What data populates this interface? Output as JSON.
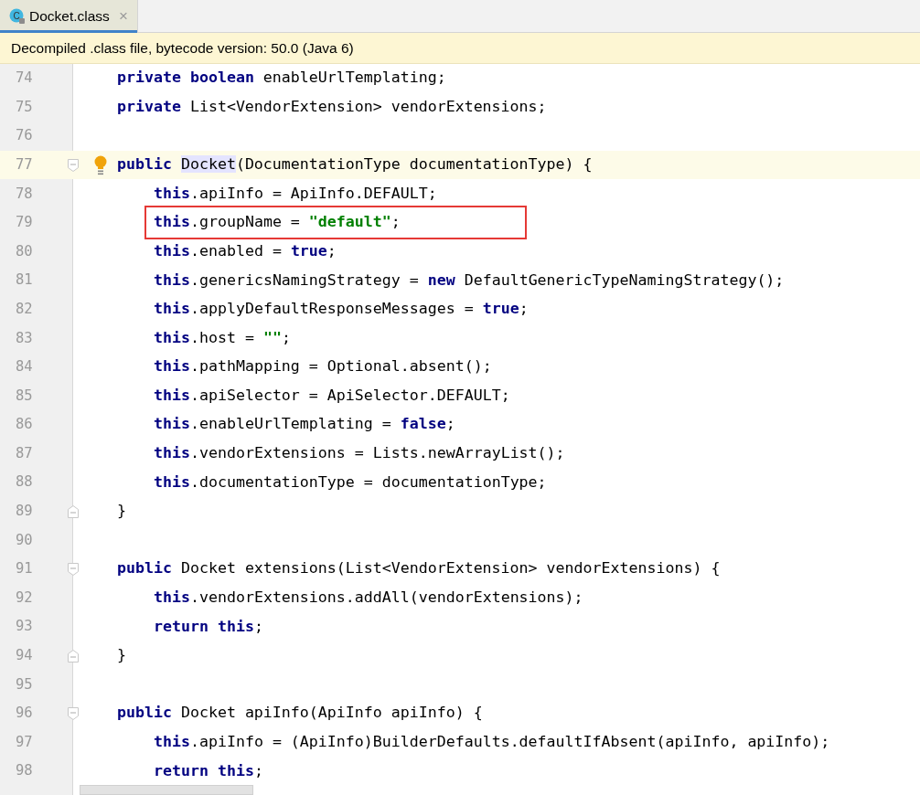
{
  "tab": {
    "title": "Docket.class",
    "file_icon_letter": "C",
    "close": "×",
    "selected": true
  },
  "banner": {
    "text": "Decompiled .class file, bytecode version: 50.0 (Java 6)"
  },
  "lines": [
    {
      "number": "74",
      "kind": "statement",
      "current": false,
      "boxed": false,
      "segments": [
        {
          "kind": "keyword",
          "text": "private "
        },
        {
          "kind": "keyword",
          "text": "boolean"
        },
        {
          "kind": "plain",
          "text": " enableUrlTemplating;"
        }
      ]
    },
    {
      "number": "75",
      "kind": "statement",
      "current": false,
      "boxed": false,
      "segments": [
        {
          "kind": "keyword",
          "text": "private"
        },
        {
          "kind": "plain",
          "text": " List<VendorExtension> vendorExtensions;"
        }
      ]
    },
    {
      "number": "76",
      "kind": "blank",
      "current": false
    },
    {
      "number": "77",
      "kind": "opening",
      "current": true,
      "boxed": false,
      "bulb": true,
      "segments": [
        {
          "kind": "keyword",
          "text": "public "
        },
        {
          "kind": "match",
          "text": "Docket"
        },
        {
          "kind": "plain",
          "text": "(DocumentationType documentationType) {"
        }
      ],
      "children": [
        {
          "number": "78",
          "kind": "statement",
          "current": false,
          "boxed": false,
          "segments": [
            {
              "kind": "keyword",
              "text": "this"
            },
            {
              "kind": "plain",
              "text": ".apiInfo = ApiInfo.DEFAULT;"
            }
          ]
        },
        {
          "number": "79",
          "kind": "statement",
          "current": false,
          "boxed": true,
          "segments": [
            {
              "kind": "keyword",
              "text": "this"
            },
            {
              "kind": "plain",
              "text": ".groupName = "
            },
            {
              "kind": "string",
              "text": "\"default\""
            },
            {
              "kind": "plain",
              "text": ";"
            }
          ]
        },
        {
          "number": "80",
          "kind": "statement",
          "current": false,
          "boxed": false,
          "segments": [
            {
              "kind": "keyword",
              "text": "this"
            },
            {
              "kind": "plain",
              "text": ".enabled = "
            },
            {
              "kind": "keyword",
              "text": "true"
            },
            {
              "kind": "plain",
              "text": ";"
            }
          ]
        },
        {
          "number": "81",
          "kind": "statement",
          "current": false,
          "boxed": false,
          "segments": [
            {
              "kind": "keyword",
              "text": "this"
            },
            {
              "kind": "plain",
              "text": ".genericsNamingStrategy = "
            },
            {
              "kind": "keyword",
              "text": "new"
            },
            {
              "kind": "plain",
              "text": " DefaultGenericTypeNamingStrategy();"
            }
          ]
        },
        {
          "number": "82",
          "kind": "statement",
          "current": false,
          "boxed": false,
          "segments": [
            {
              "kind": "keyword",
              "text": "this"
            },
            {
              "kind": "plain",
              "text": ".applyDefaultResponseMessages = "
            },
            {
              "kind": "keyword",
              "text": "true"
            },
            {
              "kind": "plain",
              "text": ";"
            }
          ]
        },
        {
          "number": "83",
          "kind": "statement",
          "current": false,
          "boxed": false,
          "segments": [
            {
              "kind": "keyword",
              "text": "this"
            },
            {
              "kind": "plain",
              "text": ".host = "
            },
            {
              "kind": "string",
              "text": "\"\""
            },
            {
              "kind": "plain",
              "text": ";"
            }
          ]
        },
        {
          "number": "84",
          "kind": "statement",
          "current": false,
          "boxed": false,
          "segments": [
            {
              "kind": "keyword",
              "text": "this"
            },
            {
              "kind": "plain",
              "text": ".pathMapping = Optional.absent();"
            }
          ]
        },
        {
          "number": "85",
          "kind": "statement",
          "current": false,
          "boxed": false,
          "segments": [
            {
              "kind": "keyword",
              "text": "this"
            },
            {
              "kind": "plain",
              "text": ".apiSelector = ApiSelector.DEFAULT;"
            }
          ]
        },
        {
          "number": "86",
          "kind": "statement",
          "current": false,
          "boxed": false,
          "segments": [
            {
              "kind": "keyword",
              "text": "this"
            },
            {
              "kind": "plain",
              "text": ".enableUrlTemplating = "
            },
            {
              "kind": "keyword",
              "text": "false"
            },
            {
              "kind": "plain",
              "text": ";"
            }
          ]
        },
        {
          "number": "87",
          "kind": "statement",
          "current": false,
          "boxed": false,
          "segments": [
            {
              "kind": "keyword",
              "text": "this"
            },
            {
              "kind": "plain",
              "text": ".vendorExtensions = Lists.newArrayList();"
            }
          ]
        },
        {
          "number": "88",
          "kind": "statement",
          "current": false,
          "boxed": false,
          "segments": [
            {
              "kind": "keyword",
              "text": "this"
            },
            {
              "kind": "plain",
              "text": ".documentationType = documentationType;"
            }
          ]
        }
      ]
    },
    {
      "number": "89",
      "kind": "closing",
      "current": false,
      "boxed": false,
      "segments": [
        {
          "kind": "plain",
          "text": "}"
        }
      ]
    },
    {
      "number": "90",
      "kind": "blank",
      "current": false
    },
    {
      "number": "91",
      "kind": "opening",
      "current": false,
      "boxed": false,
      "segments": [
        {
          "kind": "keyword",
          "text": "public"
        },
        {
          "kind": "plain",
          "text": " Docket extensions(List<VendorExtension> vendorExtensions) {"
        }
      ],
      "children": [
        {
          "number": "92",
          "kind": "statement",
          "current": false,
          "boxed": false,
          "segments": [
            {
              "kind": "keyword",
              "text": "this"
            },
            {
              "kind": "plain",
              "text": ".vendorExtensions.addAll(vendorExtensions);"
            }
          ]
        },
        {
          "number": "93",
          "kind": "statement",
          "current": false,
          "boxed": false,
          "segments": [
            {
              "kind": "keyword",
              "text": "return "
            },
            {
              "kind": "keyword",
              "text": "this"
            },
            {
              "kind": "plain",
              "text": ";"
            }
          ]
        }
      ]
    },
    {
      "number": "94",
      "kind": "closing",
      "current": false,
      "boxed": false,
      "segments": [
        {
          "kind": "plain",
          "text": "}"
        }
      ]
    },
    {
      "number": "95",
      "kind": "blank",
      "current": false
    },
    {
      "number": "96",
      "kind": "opening",
      "current": false,
      "boxed": false,
      "segments": [
        {
          "kind": "keyword",
          "text": "public"
        },
        {
          "kind": "plain",
          "text": " Docket apiInfo(ApiInfo apiInfo) {"
        }
      ],
      "children": [
        {
          "number": "97",
          "kind": "statement",
          "current": false,
          "boxed": false,
          "segments": [
            {
              "kind": "keyword",
              "text": "this"
            },
            {
              "kind": "plain",
              "text": ".apiInfo = (ApiInfo)BuilderDefaults.defaultIfAbsent(apiInfo, apiInfo);"
            }
          ]
        },
        {
          "number": "98",
          "kind": "statement",
          "current": false,
          "boxed": false,
          "segments": [
            {
              "kind": "keyword",
              "text": "return "
            },
            {
              "kind": "keyword",
              "text": "this"
            },
            {
              "kind": "plain",
              "text": ";"
            }
          ]
        }
      ]
    }
  ]
}
